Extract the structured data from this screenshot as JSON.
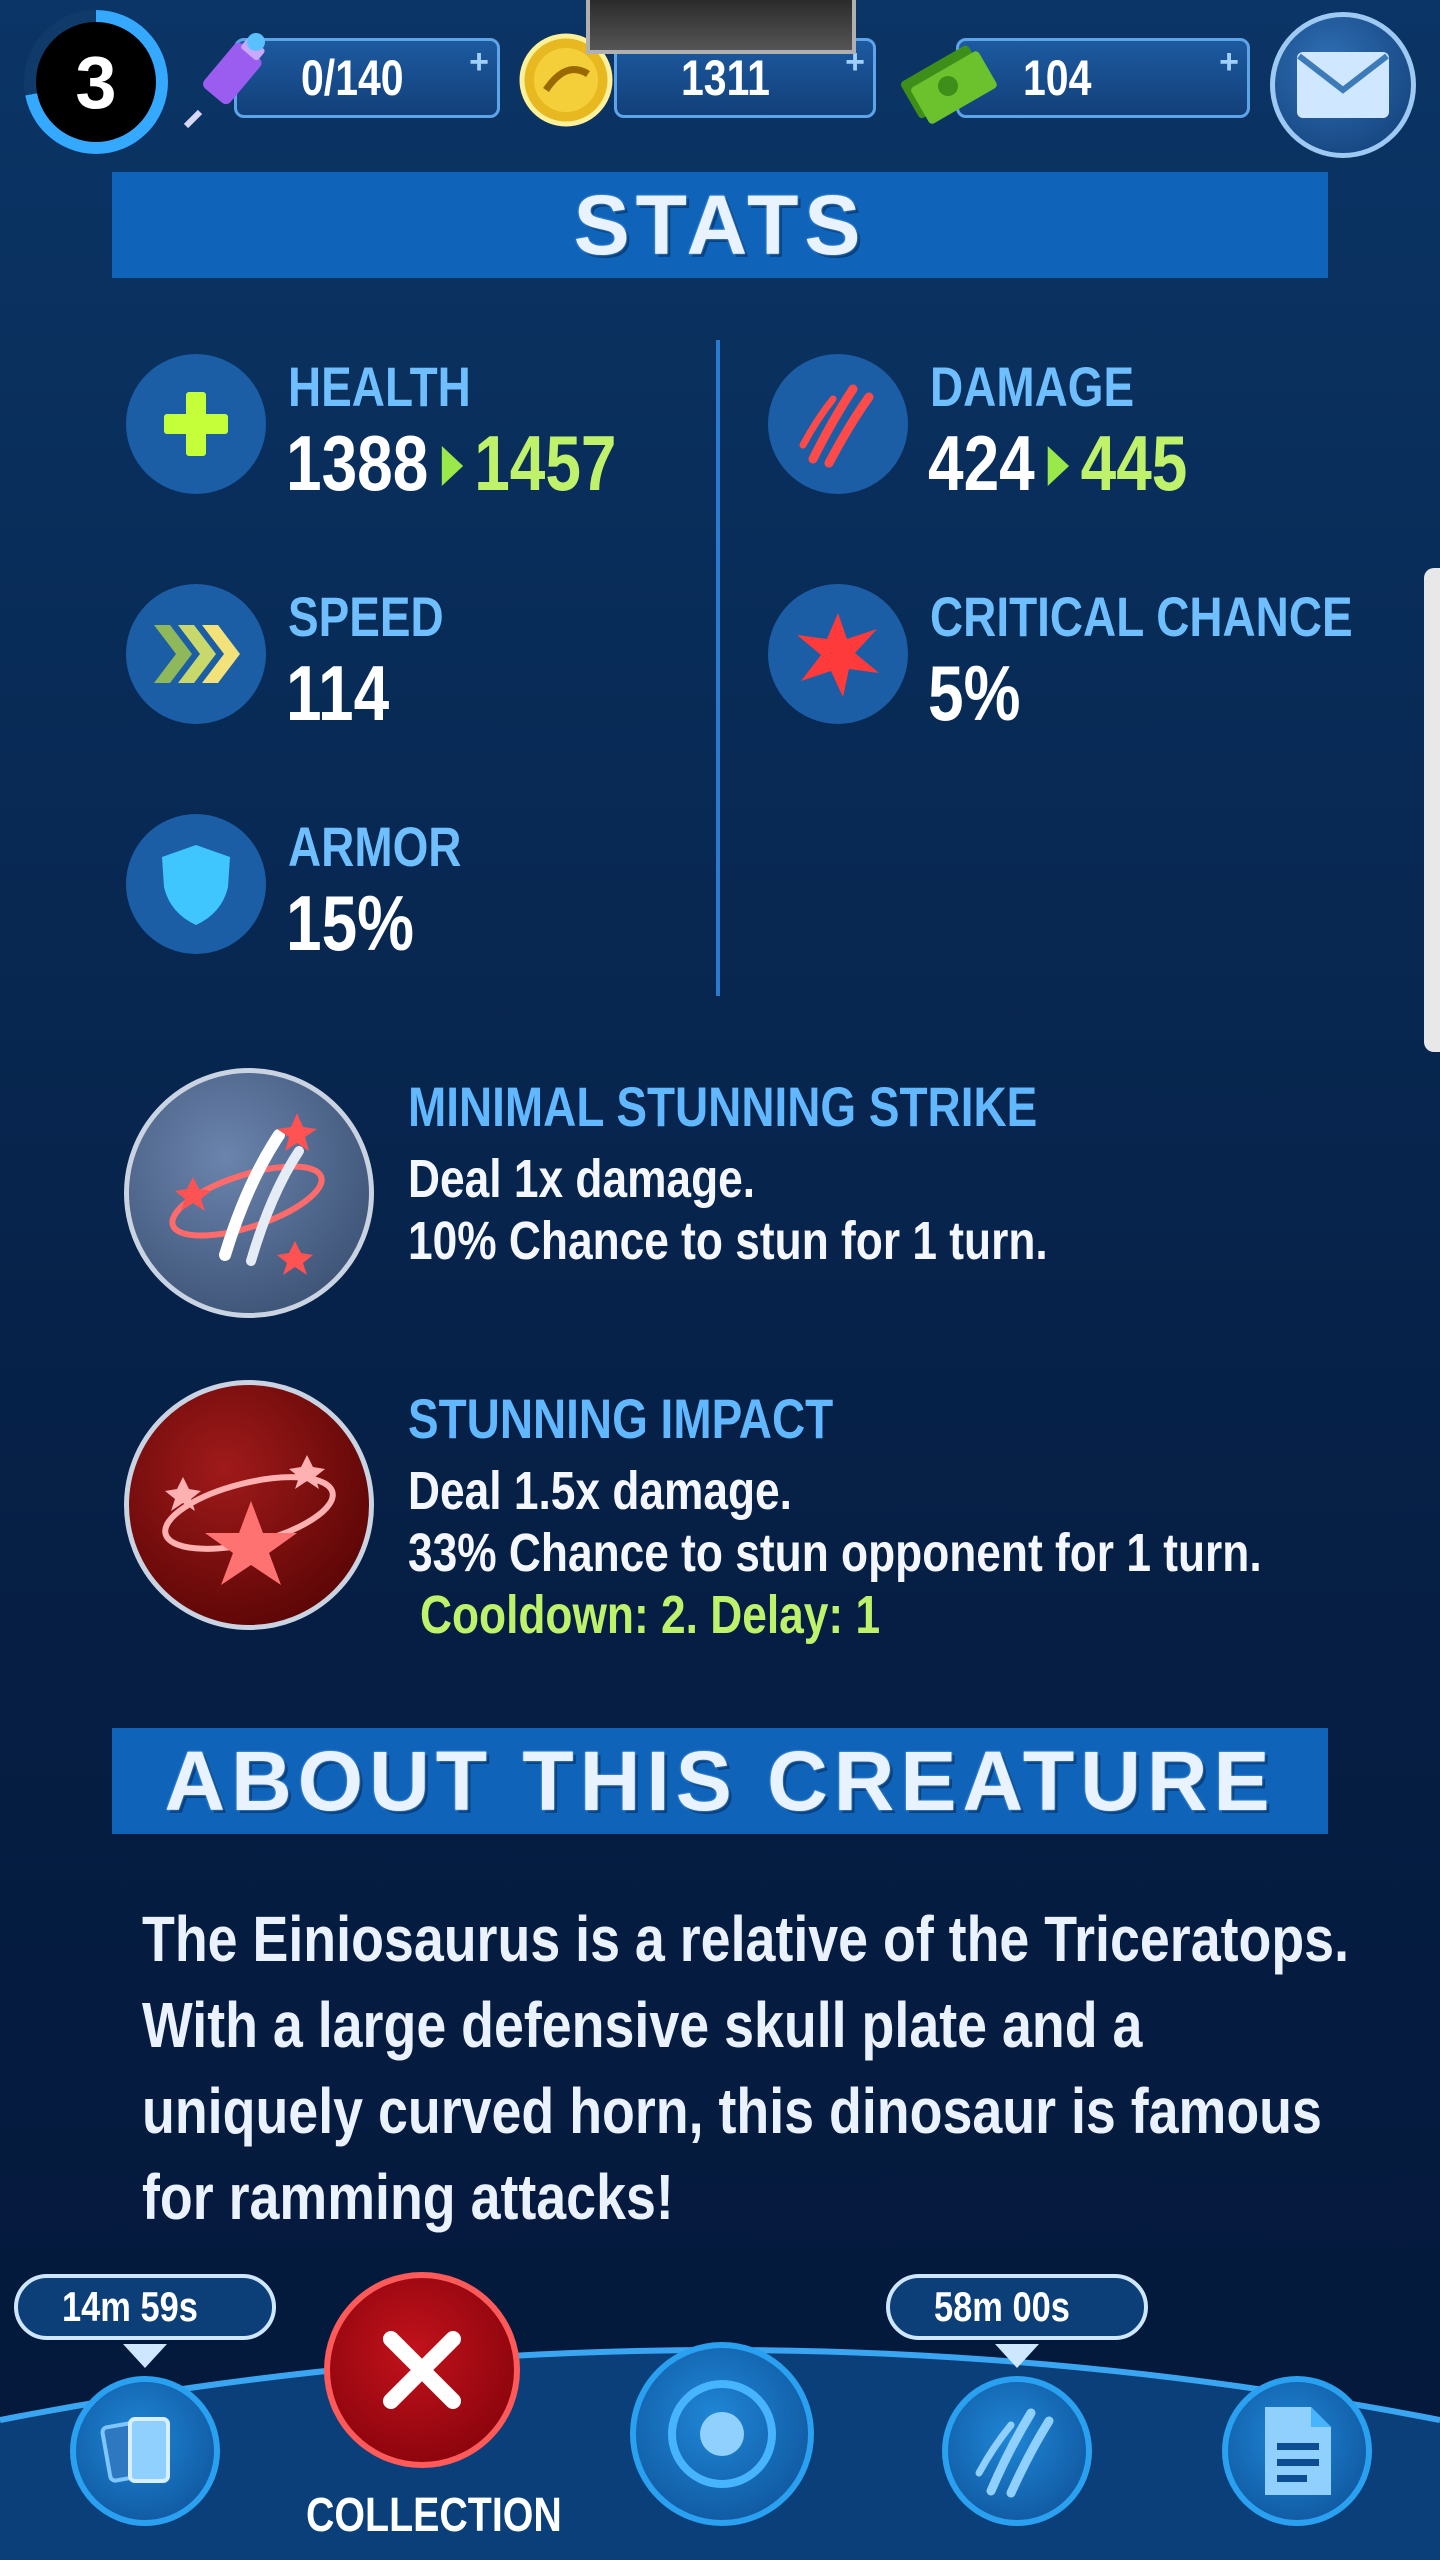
{
  "top_bar": {
    "level": "3",
    "dna": {
      "value": "0/140",
      "icon": "dna-syringe-icon"
    },
    "coins": {
      "value": "1311",
      "icon": "gold-coin-icon"
    },
    "cash": {
      "value": "104",
      "icon": "cash-stack-icon"
    },
    "plus_symbol": "+",
    "mail_icon": "envelope-icon"
  },
  "stats_section": {
    "title": "STATS",
    "health": {
      "label": "HEALTH",
      "current": "1388",
      "next": "1457",
      "icon": "plus-icon"
    },
    "damage": {
      "label": "DAMAGE",
      "current": "424",
      "next": "445",
      "icon": "claw-icon"
    },
    "speed": {
      "label": "SPEED",
      "value": "114",
      "icon": "chevrons-icon"
    },
    "critical": {
      "label": "CRITICAL CHANCE",
      "value": "5%",
      "icon": "burst-icon"
    },
    "armor": {
      "label": "ARMOR",
      "value": "15%",
      "icon": "shield-icon"
    }
  },
  "abilities": [
    {
      "name": "MINIMAL STUNNING STRIKE",
      "line1": "Deal 1x damage.",
      "line2": "10% Chance to stun for 1 turn."
    },
    {
      "name": "STUNNING IMPACT",
      "line1": "Deal 1.5x damage.",
      "line2": "33% Chance to stun opponent for 1 turn.",
      "cooldown": "Cooldown: 2. Delay: 1"
    }
  ],
  "about_section": {
    "title": "ABOUT THIS CREATURE",
    "lines": [
      "The Einiosaurus is a relative of the Triceratops.",
      "With a large defensive skull plate and a",
      "uniquely curved horn, this dinosaur is famous",
      "for ramming attacks!"
    ]
  },
  "bottom_nav": {
    "timer_left": "14m 59s",
    "timer_right": "58m 00s",
    "close_label": "COLLECTION",
    "items": [
      "cards-icon",
      "close-icon",
      "target-icon",
      "claw-icon",
      "document-icon"
    ]
  },
  "colors": {
    "accent_blue": "#0f63b8",
    "label_blue": "#6fbfff",
    "upgrade_green": "#bff26a",
    "close_red": "#c2121c"
  }
}
